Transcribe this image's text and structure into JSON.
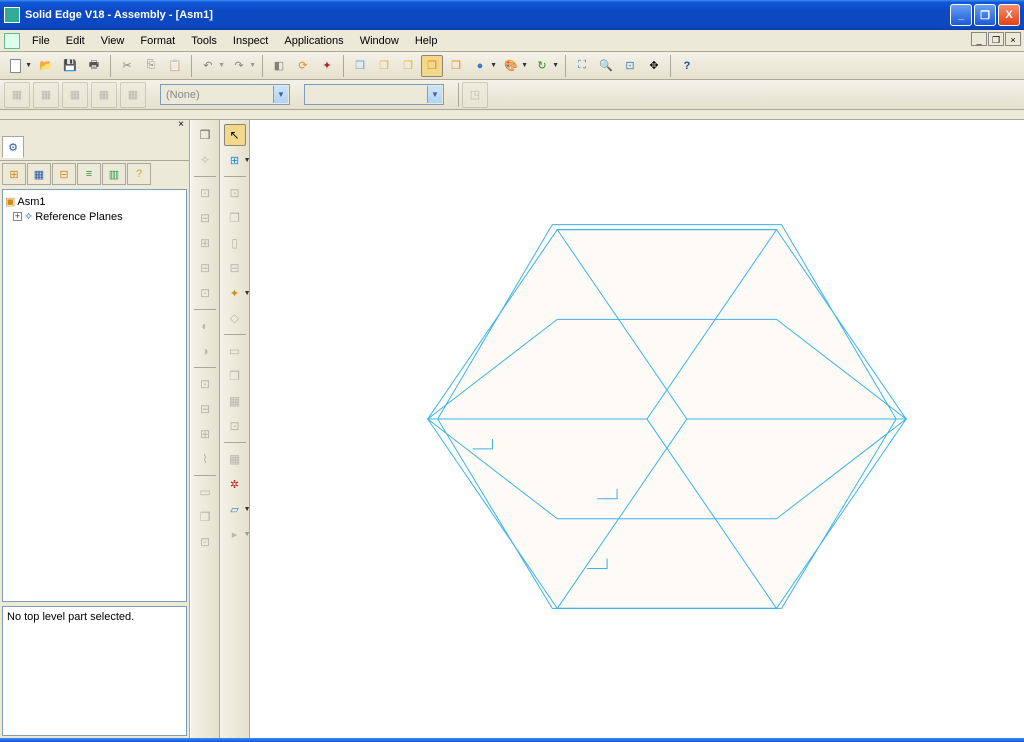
{
  "title": "Solid Edge V18 - Assembly - [Asm1]",
  "menu": {
    "items": [
      "File",
      "Edit",
      "View",
      "Format",
      "Tools",
      "Inspect",
      "Applications",
      "Window",
      "Help"
    ]
  },
  "combo1": {
    "value": "(None)"
  },
  "tree": {
    "root": {
      "label": "Asm1"
    },
    "child1": {
      "label": "Reference Planes"
    }
  },
  "infopane": {
    "text": "No top level part selected."
  }
}
